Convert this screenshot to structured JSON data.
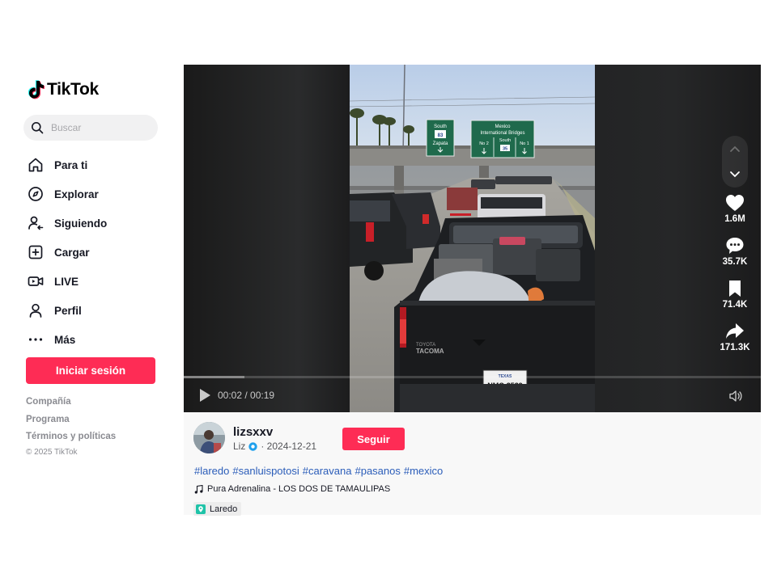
{
  "brand": {
    "name": "TikTok"
  },
  "search": {
    "placeholder": "Buscar"
  },
  "nav": {
    "items": [
      {
        "label": "Para ti",
        "icon": "home-icon"
      },
      {
        "label": "Explorar",
        "icon": "compass-icon"
      },
      {
        "label": "Siguiendo",
        "icon": "following-icon"
      },
      {
        "label": "Cargar",
        "icon": "upload-icon"
      },
      {
        "label": "LIVE",
        "icon": "live-icon"
      },
      {
        "label": "Perfil",
        "icon": "profile-icon"
      },
      {
        "label": "Más",
        "icon": "more-icon"
      }
    ]
  },
  "login": {
    "label": "Iniciar sesión"
  },
  "footer": {
    "links": [
      "Compañía",
      "Programa",
      "Términos y políticas"
    ],
    "copyright": "© 2025 TikTok"
  },
  "player": {
    "time": "00:02 / 00:19",
    "progress": 0.105,
    "signs": {
      "left": {
        "line1": "South",
        "line2": "83",
        "line3": "Zapata"
      },
      "right": {
        "line1": "Mexico",
        "line2": "International Bridges",
        "exit_left": "No 2",
        "exit_mid": "South",
        "exit_mid_route": "35",
        "exit_right": "No 1"
      }
    },
    "truck_text": {
      "brand": "TOYOTA",
      "model": "TACOMA",
      "plate_state": "TEXAS",
      "plate": "NMC-3539"
    }
  },
  "actions": [
    {
      "name": "like",
      "count": "1.6M",
      "icon": "heart-icon"
    },
    {
      "name": "comment",
      "count": "35.7K",
      "icon": "comment-icon"
    },
    {
      "name": "save",
      "count": "71.4K",
      "icon": "bookmark-icon"
    },
    {
      "name": "share",
      "count": "171.3K",
      "icon": "share-icon"
    }
  ],
  "post": {
    "username": "lizsxxv",
    "display_name": "Liz",
    "date": "· 2024-12-21",
    "follow_label": "Seguir",
    "hashtags": [
      "#laredo",
      "#sanluispotosi",
      "#caravana",
      "#pasanos",
      "#mexico"
    ],
    "music": "Pura Adrenalina - LOS DOS DE TAMAULIPAS",
    "location": "Laredo"
  },
  "colors": {
    "accent": "#fe2c55",
    "hashtag": "#2b5db9",
    "verified": "#20d5ec",
    "location_pin": "#1fc3a8"
  }
}
